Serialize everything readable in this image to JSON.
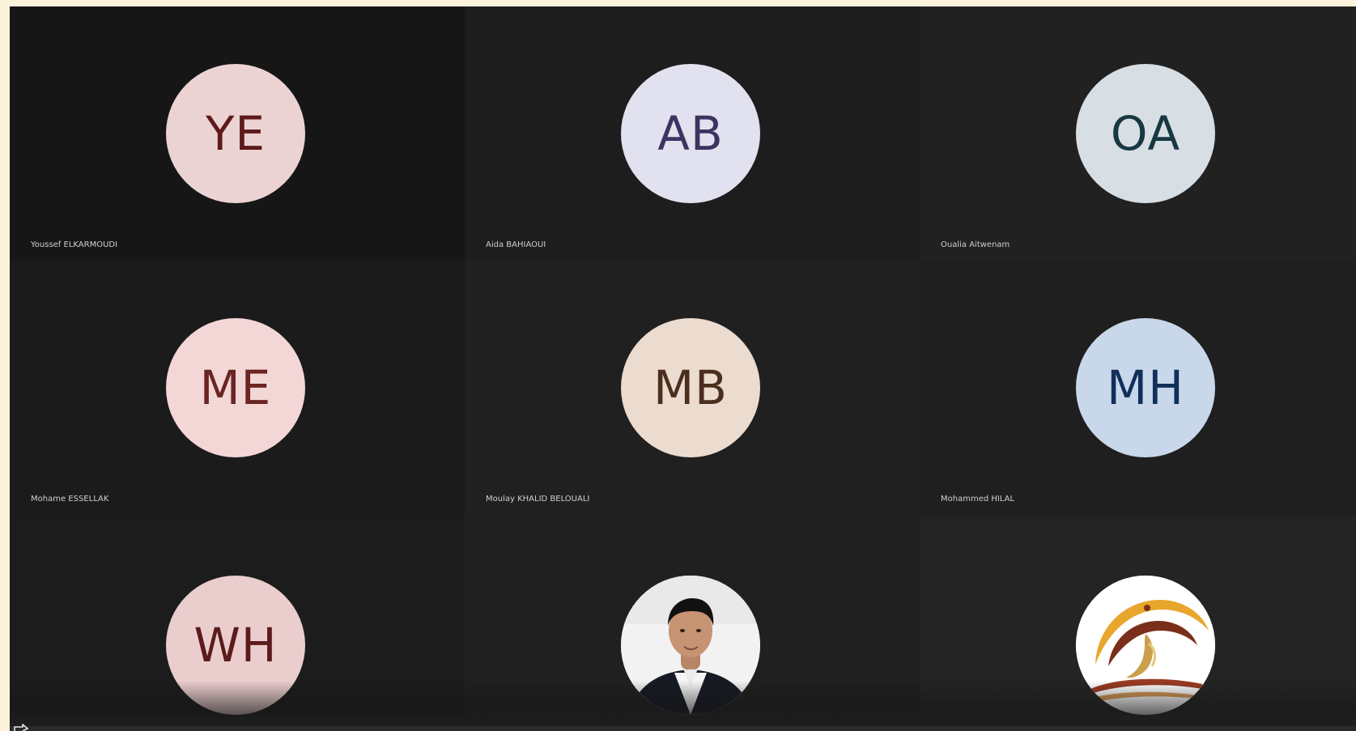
{
  "participants": [
    {
      "initials": "YE",
      "name": "Youssef ELKARMOUDI",
      "bg": "#ecd3d3",
      "fg": "#5e1a1a",
      "tile_bg": "#161616",
      "type": "initials"
    },
    {
      "initials": "AB",
      "name": "Aida BAHIAOUI",
      "bg": "#e2e1ef",
      "fg": "#3a3560",
      "tile_bg": "#1d1d1d",
      "type": "initials"
    },
    {
      "initials": "OA",
      "name": "Oualia Aitwenam",
      "bg": "#d7dee4",
      "fg": "#173741",
      "tile_bg": "#212121",
      "type": "initials"
    },
    {
      "initials": "ME",
      "name": "Mohame ESSELLAK",
      "bg": "#f3d6d6",
      "fg": "#6a2424",
      "tile_bg": "#1b1b1b",
      "type": "initials"
    },
    {
      "initials": "MB",
      "name": "Moulay KHALID BELOUALI",
      "bg": "#ecdbcf",
      "fg": "#4a2f1e",
      "tile_bg": "#202020",
      "type": "initials"
    },
    {
      "initials": "MH",
      "name": "Mohammed HILAL",
      "bg": "#c9d7ea",
      "fg": "#102f5b",
      "tile_bg": "#1f1f1f",
      "type": "initials"
    },
    {
      "initials": "WH",
      "name": "",
      "bg": "#eacdcd",
      "fg": "#5b1b1b",
      "tile_bg": "#1c1c1c",
      "type": "initials"
    },
    {
      "initials": "",
      "name": "",
      "bg": "#f1f1f1",
      "fg": "#000000",
      "tile_bg": "#202020",
      "type": "photo"
    },
    {
      "initials": "",
      "name": "",
      "bg": "#ffffff",
      "fg": "#000000",
      "tile_bg": "#242424",
      "type": "logo"
    }
  ]
}
